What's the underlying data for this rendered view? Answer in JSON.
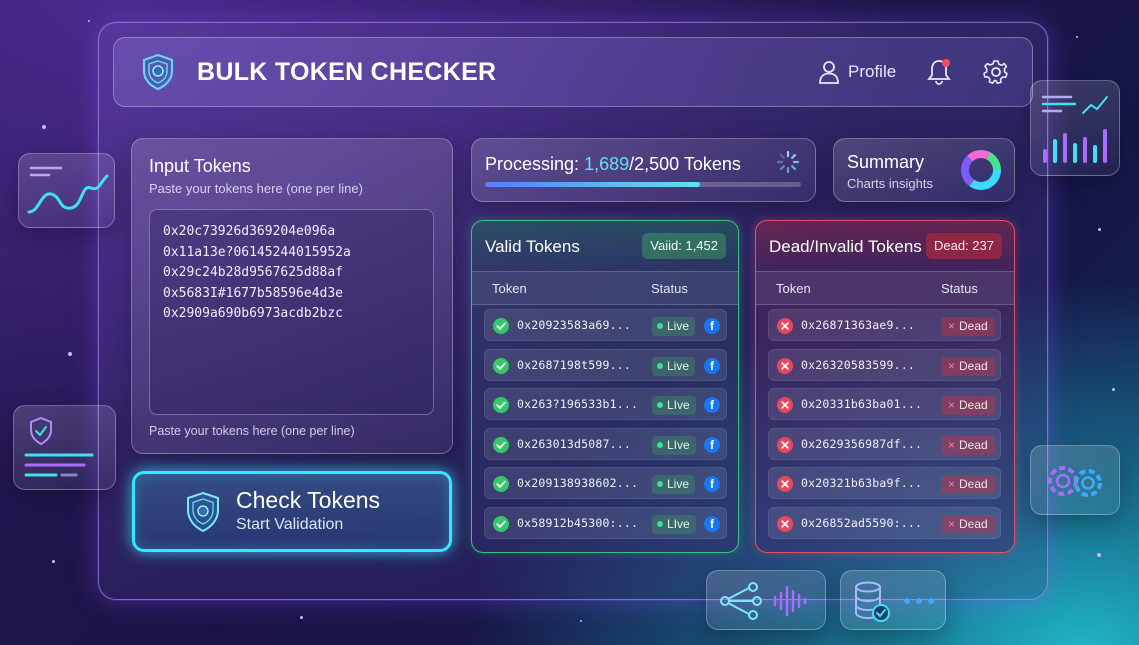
{
  "app": {
    "title": "BULK TOKEN CHECKER",
    "profile_label": "Profile"
  },
  "input": {
    "title": "Input Tokens",
    "subtitle": "Paste your tokens here (one per line)",
    "tokens": [
      "0x20c73926d369204e096a",
      "0x11a13e?06145244015952a",
      "0x29c24b28d9567625d88af",
      "0x5683I#1677b58596e4d3e",
      "0x2909a690b6973acdb2bzc"
    ],
    "footer": "Paste your tokens here (one per line)"
  },
  "check_button": {
    "label": "Check Tokens",
    "sublabel": "Start Validation"
  },
  "processing": {
    "prefix": "Processing:",
    "done": "1,689",
    "total": "/2,500 Tokens",
    "progress_fraction": 0.68
  },
  "summary": {
    "title": "Summary",
    "subtitle": "Charts insights"
  },
  "valid": {
    "title": "Valid Tokens",
    "badge": "Vaiid: 1,452",
    "col_token": "Token",
    "col_status": "Status",
    "rows": [
      {
        "token": "0x20923583a69...",
        "status": "Live"
      },
      {
        "token": "0x2687198t599...",
        "status": "Live"
      },
      {
        "token": "0x263?196533b1...",
        "status": "LIve"
      },
      {
        "token": "0x263013d5087...",
        "status": "LIve"
      },
      {
        "token": "0x209138938602...",
        "status": "Live"
      },
      {
        "token": "0x58912b45300:...",
        "status": "LIve"
      }
    ]
  },
  "dead": {
    "title": "Dead/Invalid Tokens",
    "badge": "Dead: 237",
    "col_token": "Token",
    "col_status": "Status",
    "rows": [
      {
        "token": "0x26871363ae9...",
        "status": "Dead"
      },
      {
        "token": "0x26320583599...",
        "status": "Dead"
      },
      {
        "token": "0x20331b63ba01...",
        "status": "Dead"
      },
      {
        "token": "0x2629356987df...",
        "status": "Dead"
      },
      {
        "token": "0x20321b63ba9f...",
        "status": "Dead"
      },
      {
        "token": "0x26852ad5590:...",
        "status": "Dead"
      }
    ]
  },
  "colors": {
    "accent_cyan": "#37e6ff",
    "valid_green": "#39c07a",
    "dead_red": "#e05364",
    "facebook_blue": "#1877f2"
  },
  "icons": [
    "shield-icon",
    "user-icon",
    "bell-icon",
    "gear-icon",
    "spinner-icon",
    "donut-chart-icon",
    "check-circle-icon",
    "x-circle-icon",
    "facebook-icon",
    "line-chart-icon",
    "bar-chart-icon",
    "gears-icon",
    "network-icon",
    "waveform-icon",
    "database-check-icon",
    "more-dots-icon"
  ]
}
